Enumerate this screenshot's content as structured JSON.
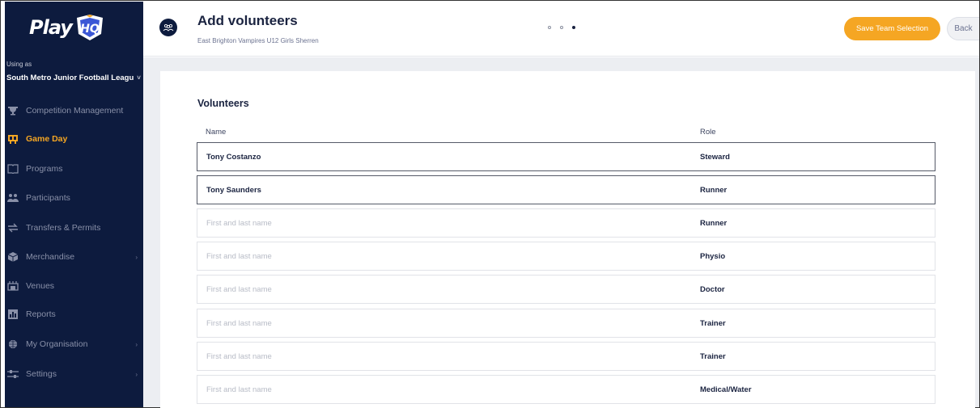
{
  "brand": {
    "logo_left": "Play",
    "logo_right": "HQ"
  },
  "sidebar": {
    "using_as": "Using as",
    "organisation": "South Metro Junior Football Leagu",
    "items": [
      {
        "label": "Competition Management",
        "icon": "trophy-icon",
        "active": false
      },
      {
        "label": "Game Day",
        "icon": "scoreboard-icon",
        "active": true
      },
      {
        "label": "Programs",
        "icon": "book-icon",
        "active": false
      },
      {
        "label": "Participants",
        "icon": "people-icon",
        "active": false
      },
      {
        "label": "Transfers & Permits",
        "icon": "transfer-icon",
        "active": false
      },
      {
        "label": "Merchandise",
        "icon": "box-icon",
        "active": false,
        "expandable": true
      },
      {
        "label": "Venues",
        "icon": "stadium-icon",
        "active": false
      },
      {
        "label": "Reports",
        "icon": "chart-icon",
        "active": false
      },
      {
        "label": "My Organisation",
        "icon": "globe-icon",
        "active": false,
        "expandable": true
      },
      {
        "label": "Settings",
        "icon": "sliders-icon",
        "active": false,
        "expandable": true
      }
    ]
  },
  "header": {
    "title": "Add volunteers",
    "subtitle": "East Brighton Vampires U12 Girls Sherren",
    "step_current": 3,
    "step_total": 3,
    "save_label": "Save Team Selection",
    "back_label": "Back"
  },
  "volunteers": {
    "title": "Volunteers",
    "col_name": "Name",
    "col_role": "Role",
    "placeholder": "First and last name",
    "rows": [
      {
        "name": "Tony Costanzo",
        "role": "Steward"
      },
      {
        "name": "Tony Saunders",
        "role": "Runner"
      },
      {
        "name": "",
        "role": "Runner"
      },
      {
        "name": "",
        "role": "Physio"
      },
      {
        "name": "",
        "role": "Doctor"
      },
      {
        "name": "",
        "role": "Trainer"
      },
      {
        "name": "",
        "role": "Trainer"
      },
      {
        "name": "",
        "role": "Medical/Water"
      }
    ]
  },
  "colors": {
    "sidebar": "#0d1b3e",
    "accent": "#f5a623",
    "text": "#1a2340"
  }
}
